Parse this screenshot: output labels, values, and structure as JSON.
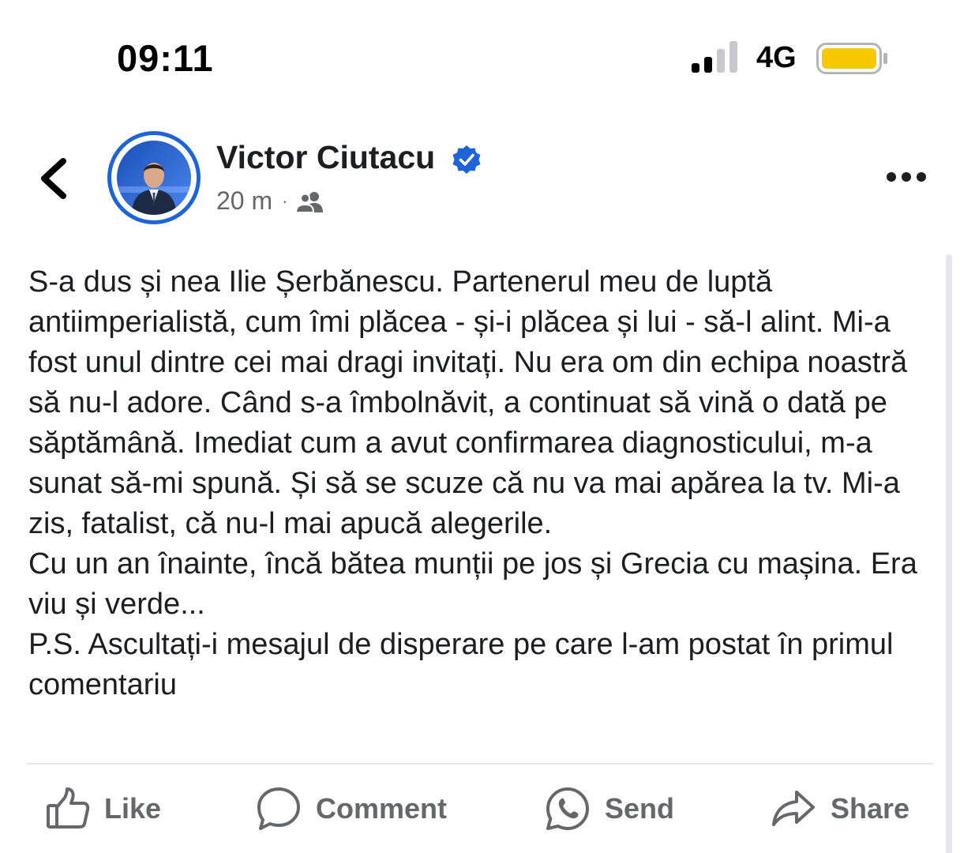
{
  "status_bar": {
    "time": "09:11",
    "network": "4G",
    "battery_color": "#f7c900",
    "icons": [
      "cellular-signal-icon",
      "battery-icon"
    ]
  },
  "post": {
    "author": "Victor Ciutacu",
    "verified": true,
    "timestamp": "20 m",
    "separator": "·",
    "audience_icon": "friends-icon",
    "paragraphs": [
      "S-a dus și nea Ilie Șerbănescu. Partenerul meu de luptă antiimperialistă, cum îmi plăcea - și-i plăcea și lui - să-l alint. Mi-a fost unul dintre cei mai dragi invitați. Nu era om din echipa noastră să nu-l adore. Când s-a îmbolnăvit, a continuat să vină o dată pe săptămână. Imediat cum a avut confirmarea diagnosticului, m-a sunat să-mi spună. Și să se scuze că nu va mai apărea la tv. Mi-a zis, fatalist, că nu-l mai apucă alegerile.",
      "Cu un an înainte, încă bătea munții pe jos și Grecia cu mașina. Era viu și verde...",
      "P.S. Ascultați-i mesajul de disperare pe care l-am postat în primul comentariu"
    ]
  },
  "actions": {
    "like": "Like",
    "comment": "Comment",
    "send": "Send",
    "share": "Share"
  },
  "colors": {
    "accent": "#1e64d8",
    "secondary_text": "#65676b",
    "primary_text": "#1c1e21"
  }
}
